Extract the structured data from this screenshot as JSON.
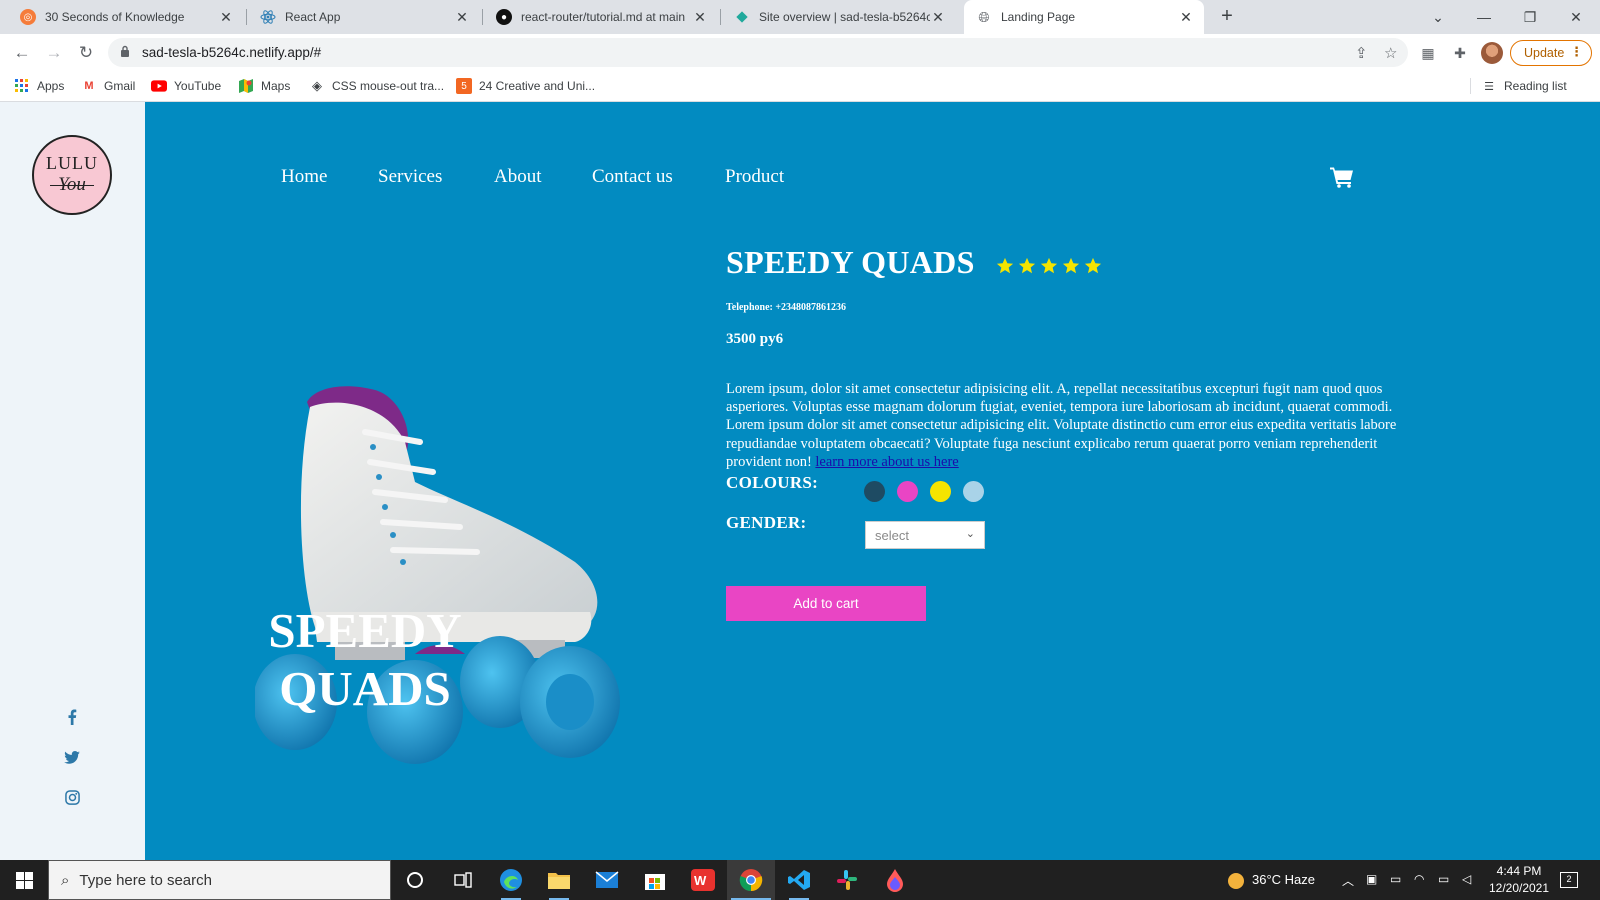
{
  "browser": {
    "tabs": [
      {
        "title": "30 Seconds of Knowledge",
        "favicon": "circle-icon"
      },
      {
        "title": "React App",
        "favicon": "react-icon"
      },
      {
        "title": "react-router/tutorial.md at main",
        "favicon": "github-icon"
      },
      {
        "title": "Site overview | sad-tesla-b5264c",
        "favicon": "netlify-icon"
      },
      {
        "title": "Landing Page",
        "favicon": "globe-icon",
        "active": true
      }
    ],
    "url": "sad-tesla-b5264c.netlify.app/#",
    "update_label": "Update",
    "bookmarks": [
      {
        "label": "Apps"
      },
      {
        "label": "Gmail"
      },
      {
        "label": "YouTube"
      },
      {
        "label": "Maps"
      },
      {
        "label": "CSS mouse-out tra..."
      },
      {
        "label": "24 Creative and Uni..."
      }
    ],
    "reading_list": "Reading list"
  },
  "site": {
    "logo": {
      "line1": "LULU",
      "line2": "You"
    },
    "nav": [
      "Home",
      "Services",
      "About",
      "Contact us",
      "Product"
    ],
    "hero_title_line1": "SPEEDY",
    "hero_title_line2": "QUADS",
    "product": {
      "name": "SPEEDY QUADS",
      "rating": 5,
      "telephone": "Telephone: +2348087861236",
      "price": "3500 py6",
      "description": "Lorem ipsum, dolor sit amet consectetur adipisicing elit. A, repellat necessitatibus excepturi fugit nam quod quos asperiores. Voluptas esse magnam dolorum fugiat, eveniet, tempora iure laboriosam ab incidunt, quaerat commodi. Lorem ipsum dolor sit amet consectetur adipisicing elit. Voluptate distinctio cum error eius expedita veritatis labore repudiandae voluptatem obcaecati? Voluptate fuga nesciunt explicabo rerum quaerat porro veniam reprehenderit provident non!",
      "learn_more": "learn more about us here",
      "colours_label": "COLOURS:",
      "colours": [
        "#1e4b63",
        "#e945c4",
        "#f5e400",
        "#a9d3e8"
      ],
      "gender_label": "GENDER:",
      "gender_selected": "select",
      "add_to_cart": "Add to cart"
    },
    "colors": {
      "page_bg": "#028bc1",
      "sidebar_bg": "#eef4f9",
      "accent": "#e945c4",
      "star": "#f5e400"
    }
  },
  "taskbar": {
    "search_placeholder": "Type here to search",
    "weather": "36°C  Haze",
    "time": "4:44 PM",
    "date": "12/20/2021",
    "notifications": "2"
  }
}
